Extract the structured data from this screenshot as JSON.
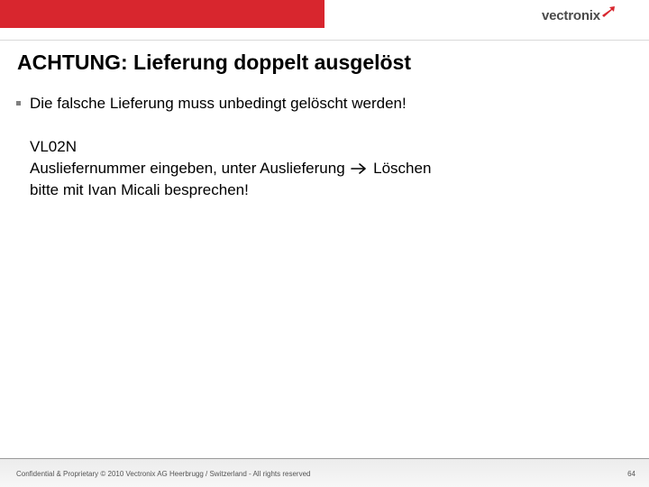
{
  "header": {
    "logo_text": "vectronix",
    "accent_color": "#d8262e",
    "logo_icon": "vectronix-swoosh-icon"
  },
  "slide": {
    "title": "ACHTUNG: Lieferung doppelt ausgelöst",
    "bullets": [
      {
        "text": "Die falsche Lieferung muss unbedingt gelöscht werden!"
      }
    ],
    "lines": {
      "line1": "VL02N",
      "line2_before": "Ausliefernummer eingeben, unter Auslieferung",
      "line2_arrow_icon": "right-arrow-icon",
      "line2_after": "Löschen",
      "line3": "bitte mit Ivan Micali besprechen!"
    }
  },
  "footer": {
    "text": "Confidential & Proprietary © 2010 Vectronix AG Heerbrugg / Switzerland - All rights reserved",
    "page_number": "64"
  }
}
